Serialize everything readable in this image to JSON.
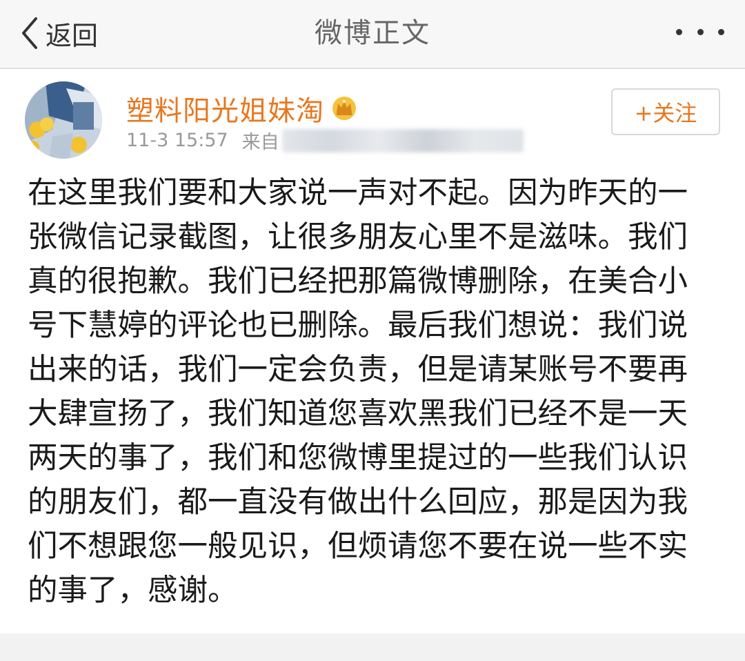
{
  "navbar": {
    "back_label": "返回",
    "title": "微博正文"
  },
  "post": {
    "username": "塑料阳光姐妹淘",
    "time": "11-3 15:57",
    "source_prefix": "来自",
    "follow_label": "+关注",
    "text": "在这里我们要和大家说一声对不起。因为昨天的一张微信记录截图，让很多朋友心里不是滋味。我们真的很抱歉。我们已经把那篇微博删除，在美合小号下慧婷的评论也已删除。最后我们想说：我们说出来的话，我们一定会负责，但是请某账号不要再大肆宣扬了，我们知道您喜欢黑我们已经不是一天两天的事了，我们和您微博里提过的一些我们认识的朋友们，都一直没有做出什么回应，那是因为我们不想跟您一般见识，但烦请您不要在说一些不实的事了，感谢。"
  },
  "icons": {
    "back": "chevron-left-icon",
    "more": "more-dots-icon",
    "vip": "crown-icon"
  },
  "colors": {
    "username": "#e8771f",
    "follow": "#e8771f",
    "meta": "#999999",
    "navbar_bg": "#f7f7f7"
  }
}
